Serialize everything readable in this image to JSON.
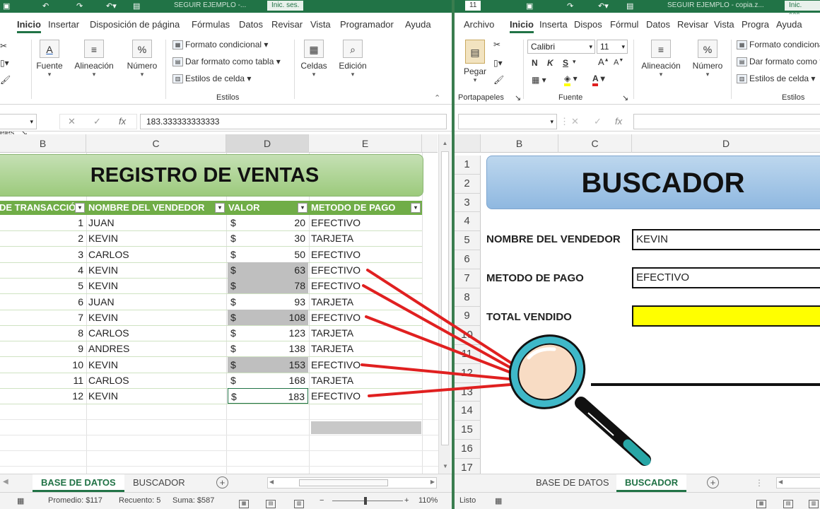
{
  "left": {
    "titlebar": {
      "doc_name": "SEGUIR EJEMPLO -...",
      "signin": "Inic. ses."
    },
    "menu": [
      "Inicio",
      "Insertar",
      "Disposición de página",
      "Fórmulas",
      "Datos",
      "Revisar",
      "Vista",
      "Programador",
      "Ayuda"
    ],
    "menu_active": "Inicio",
    "ribbon": {
      "partial_label": "eles",
      "font_label": "Fuente",
      "align_label": "Alineación",
      "number_label": "Número",
      "number_icon": "%",
      "cond_format": "Formato condicional",
      "table_format": "Dar formato como tabla",
      "cell_styles": "Estilos de celda",
      "styles_group": "Estilos",
      "cells_label": "Celdas",
      "edit_label": "Edición"
    },
    "formula_value": "183.333333333333",
    "columns": [
      "B",
      "C",
      "D",
      "E"
    ],
    "banner": "REGISTRO DE VENTAS",
    "headers": [
      "DE TRANSACCIÓN",
      "NOMBRE DEL VENDEDOR",
      "VALOR",
      "METODO DE PAGO"
    ],
    "currency": "$",
    "rows": [
      {
        "n": "1",
        "name": "JUAN",
        "val": "20",
        "pay": "EFECTIVO",
        "hl": false
      },
      {
        "n": "2",
        "name": "KEVIN",
        "val": "30",
        "pay": "TARJETA",
        "hl": false
      },
      {
        "n": "3",
        "name": "CARLOS",
        "val": "50",
        "pay": "EFECTIVO",
        "hl": false
      },
      {
        "n": "4",
        "name": "KEVIN",
        "val": "63",
        "pay": "EFECTIVO",
        "hl": true
      },
      {
        "n": "5",
        "name": "KEVIN",
        "val": "78",
        "pay": "EFECTIVO",
        "hl": true
      },
      {
        "n": "6",
        "name": "JUAN",
        "val": "93",
        "pay": "TARJETA",
        "hl": false
      },
      {
        "n": "7",
        "name": "KEVIN",
        "val": "108",
        "pay": "EFECTIVO",
        "hl": true
      },
      {
        "n": "8",
        "name": "CARLOS",
        "val": "123",
        "pay": "TARJETA",
        "hl": false
      },
      {
        "n": "9",
        "name": "ANDRES",
        "val": "138",
        "pay": "TARJETA",
        "hl": false
      },
      {
        "n": "10",
        "name": "KEVIN",
        "val": "153",
        "pay": "EFECTIVO",
        "hl": true
      },
      {
        "n": "11",
        "name": "CARLOS",
        "val": "168",
        "pay": "TARJETA",
        "hl": false
      },
      {
        "n": "12",
        "name": "KEVIN",
        "val": "183",
        "pay": "EFECTIVO",
        "hl": false
      }
    ],
    "tabs": [
      "BASE DE DATOS",
      "BUSCADOR"
    ],
    "active_tab": "BASE DE DATOS",
    "status": {
      "promedio": "Promedio:  $117",
      "recuento": "Recuento: 5",
      "suma": "Suma:  $587",
      "zoom": "110%"
    }
  },
  "right": {
    "titlebar": {
      "font_size": "11",
      "doc_name": "SEGUIR EJEMPLO - copia.z...",
      "signin": "Inic. ses."
    },
    "menu": [
      "Archivo",
      "Inicio",
      "Inserta",
      "Dispos",
      "Fórmul",
      "Datos",
      "Revisar",
      "Vista",
      "Progra",
      "Ayuda"
    ],
    "menu_active": "Inicio",
    "ribbon": {
      "paste_label": "Pegar",
      "clipboard_group": "Portapapeles",
      "font_name": "Calibri",
      "font_size": "11",
      "bold": "N",
      "italic": "K",
      "underline": "S",
      "font_group": "Fuente",
      "align_label": "Alineación",
      "number_label": "Número",
      "number_icon": "%",
      "cond_format": "Formato condicional",
      "table_format": "Dar formato como tabla",
      "cell_styles": "Estilos de celda",
      "styles_group": "Estilos"
    },
    "columns": [
      "B",
      "C",
      "D"
    ],
    "row_numbers": [
      "1",
      "2",
      "3",
      "4",
      "5",
      "6",
      "7",
      "8",
      "9",
      "10",
      "11",
      "12",
      "13",
      "14",
      "15",
      "16",
      "17"
    ],
    "banner": "BUSCADOR",
    "labels": {
      "vendor": "NOMBRE DEL VENDEDOR",
      "payment": "METODO DE PAGO",
      "total": "TOTAL VENDIDO"
    },
    "values": {
      "vendor": "KEVIN",
      "payment": "EFECTIVO"
    },
    "tabs": [
      "BASE DE DATOS",
      "BUSCADOR"
    ],
    "active_tab": "BUSCADOR",
    "status": {
      "ready": "Listo"
    }
  },
  "colors": {
    "excel_green": "#217346",
    "table_header": "#70ad47",
    "banner_left": "#a9d18e",
    "banner_right": "#9dc3e6",
    "highlight": "#bfbfbf",
    "total_fill": "#ffff00",
    "arrow_red": "#e02020",
    "magnifier_cyan": "#3fb8c8"
  },
  "icons": [
    "cut-icon",
    "copy-icon",
    "format-painter-icon",
    "font-a-icon",
    "align-icon",
    "percent-icon",
    "cells-icon",
    "search-icon",
    "paste-icon",
    "cancel-icon",
    "confirm-icon",
    "fx-icon",
    "filter-dropdown-icon",
    "add-sheet-icon",
    "magnifier-illustration"
  ]
}
